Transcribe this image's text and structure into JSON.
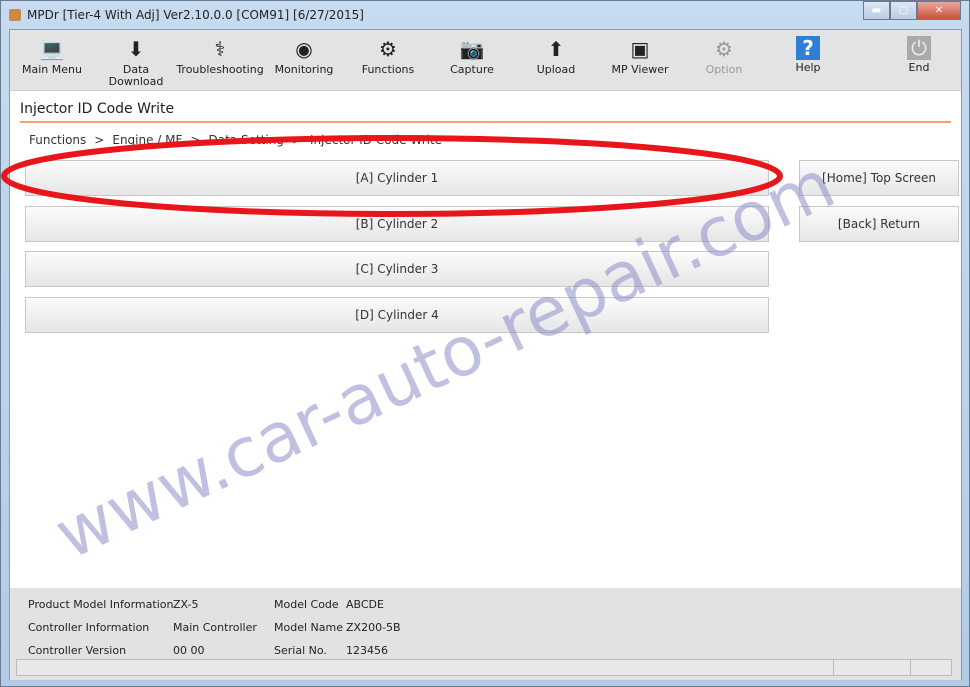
{
  "window": {
    "title": "MPDr [Tier-4 With Adj] Ver2.10.0.0 [COM91] [6/27/2015]"
  },
  "toolbar": [
    {
      "label": "Main Menu",
      "icon": "main-menu-icon",
      "glyph": "💻",
      "enabled": true
    },
    {
      "label": "Data Download",
      "icon": "download-icon",
      "glyph": "⬇",
      "enabled": true
    },
    {
      "label": "Troubleshooting",
      "icon": "stethoscope-icon",
      "glyph": "⚕",
      "enabled": true
    },
    {
      "label": "Monitoring",
      "icon": "gauge-icon",
      "glyph": "◉",
      "enabled": true
    },
    {
      "label": "Functions",
      "icon": "functions-icon",
      "glyph": "⚙",
      "enabled": true
    },
    {
      "label": "Capture",
      "icon": "camera-icon",
      "glyph": "📷",
      "enabled": true
    },
    {
      "label": "Upload",
      "icon": "upload-icon",
      "glyph": "⬆",
      "enabled": true
    },
    {
      "label": "MP Viewer",
      "icon": "viewer-icon",
      "glyph": "▣",
      "enabled": true
    },
    {
      "label": "Option",
      "icon": "gear-icon",
      "glyph": "⚙",
      "enabled": false
    },
    {
      "label": "Help",
      "icon": "help-icon",
      "glyph": "?",
      "enabled": true
    },
    {
      "label": "End",
      "icon": "power-icon",
      "glyph": "⏻",
      "enabled": true
    }
  ],
  "page": {
    "title": "Injector ID Code Write",
    "breadcrumb": [
      "Functions",
      ">",
      "Engine / MF",
      ">",
      "Data Setting",
      ">",
      "Injector ID Code Write"
    ]
  },
  "buttons": {
    "cyl1": "[A] Cylinder 1",
    "cyl2": "[B] Cylinder 2",
    "cyl3": "[C] Cylinder 3",
    "cyl4": "[D] Cylinder 4",
    "home": "[Home] Top Screen",
    "back": "[Back] Return"
  },
  "footer": {
    "product_label": "Product Model Information",
    "product_value": "ZX-5",
    "controller_label": "Controller Information",
    "controller_value": "Main Controller",
    "version_label": "Controller Version",
    "version_value": "00 00",
    "model_code_label": "Model Code",
    "model_code_value": "ABCDE",
    "model_name_label": "Model Name",
    "model_name_value": "ZX200-5B",
    "serial_label": "Serial No.",
    "serial_value": "123456"
  },
  "watermark": "www.car-auto-repair.com",
  "colors": {
    "accent_line": "#f4a46a",
    "annotation": "#e8161b"
  }
}
